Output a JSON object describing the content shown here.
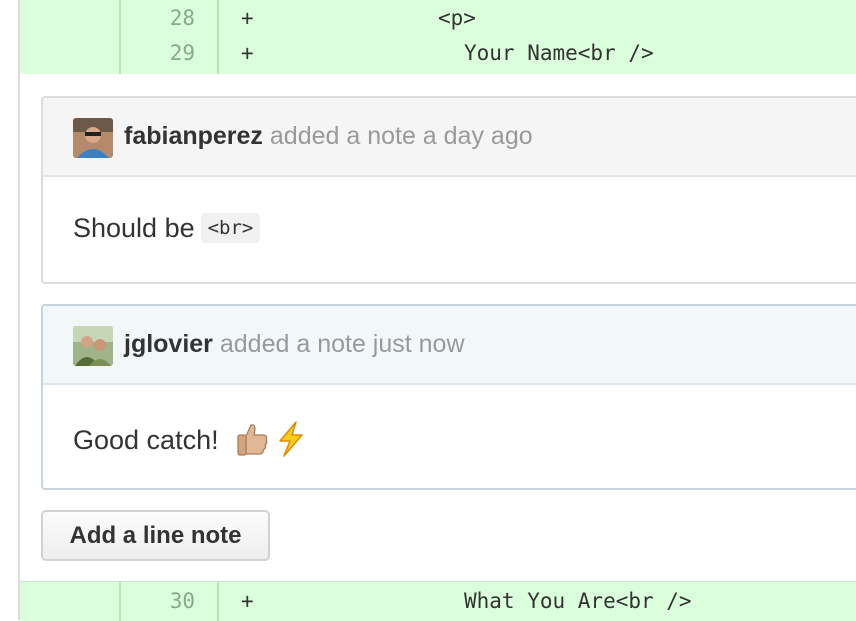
{
  "diff_top": [
    {
      "line": "28",
      "sign": "+",
      "code": "<p>"
    },
    {
      "line": "29",
      "sign": "+",
      "code": "Your Name<br />"
    }
  ],
  "diff_bottom": {
    "line": "30",
    "sign": "+",
    "code": "What You Are<br />"
  },
  "notes": [
    {
      "author": "fabianperez",
      "action": "added a note a day ago",
      "body_text": "Should be",
      "body_code": "<br>",
      "avatar_icon": "user-avatar-icon"
    },
    {
      "author": "jglovier",
      "action": "added a note just now",
      "body_text": "Good catch!",
      "emoji": [
        "thumbs-up-icon",
        "lightning-icon"
      ],
      "avatar_icon": "user-avatar-icon"
    }
  ],
  "add_note_button": "Add a line note",
  "colors": {
    "diff_added_bg": "#dbffdb",
    "author": "#333333",
    "meta": "#999999"
  }
}
